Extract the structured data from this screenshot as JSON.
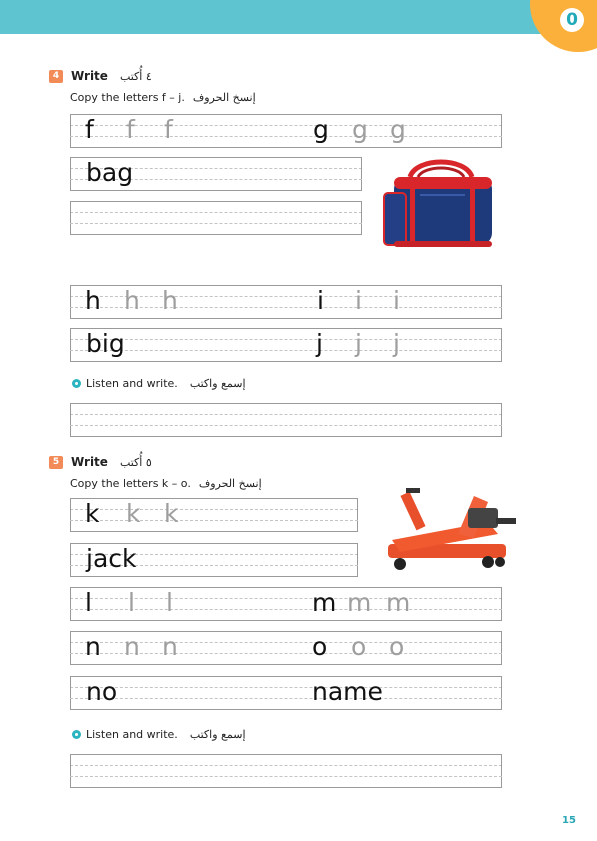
{
  "header": {
    "unit_number": "0"
  },
  "exercise4": {
    "number": "4",
    "title": "Write",
    "title_ar": "٤ أُكتب",
    "instruction": "Copy the letters f – j.",
    "instruction_ar": "إنسخ الحروف",
    "rows": {
      "f": [
        "f",
        "f",
        "f"
      ],
      "g": [
        "g",
        "g",
        "g"
      ],
      "bag": "bag",
      "h": [
        "h",
        "h",
        "h"
      ],
      "i": [
        "i",
        "i",
        "i"
      ],
      "big": "big",
      "j": [
        "j",
        "j",
        "j"
      ]
    },
    "listen_label": "Listen and write.",
    "listen_ar": "إسمع واكتب"
  },
  "exercise5": {
    "number": "5",
    "title": "Write",
    "title_ar": "٥ أُكتب",
    "instruction": "Copy the letters k – o.",
    "instruction_ar": "إنسخ الحروف",
    "rows": {
      "k": [
        "k",
        "k",
        "k"
      ],
      "jack": "jack",
      "l": [
        "l",
        "l",
        "l"
      ],
      "m": [
        "m",
        "m",
        "m"
      ],
      "n": [
        "n",
        "n",
        "n"
      ],
      "o": [
        "o",
        "o",
        "o"
      ],
      "no": "no",
      "name": "name"
    },
    "listen_label": "Listen and write.",
    "listen_ar": "إسمع واكتب"
  },
  "footer": {
    "page_number": "15"
  },
  "colors": {
    "header_bar": "#5ec4cf",
    "unit_circle": "#fbb03b",
    "exercise_badge": "#f28b57",
    "audio_icon": "#2bb5c0"
  }
}
